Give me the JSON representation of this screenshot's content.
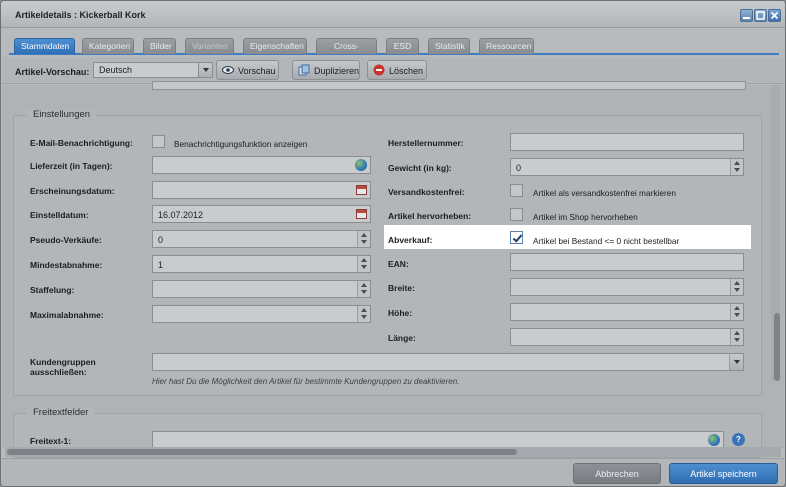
{
  "window": {
    "title": "Artikeldetails : Kickerball Kork"
  },
  "tabs": [
    {
      "label": "Stammdaten",
      "state": "active"
    },
    {
      "label": "Kategorien",
      "state": "normal"
    },
    {
      "label": "Bilder",
      "state": "normal"
    },
    {
      "label": "Varianten",
      "state": "disabled"
    },
    {
      "label": "Eigenschaften",
      "state": "normal"
    },
    {
      "label": "Cross-Selling",
      "state": "normal"
    },
    {
      "label": "ESD",
      "state": "normal"
    },
    {
      "label": "Statistik",
      "state": "normal"
    },
    {
      "label": "Ressourcen",
      "state": "normal"
    }
  ],
  "toolbar": {
    "preview_label": "Artikel-Vorschau:",
    "language_value": "Deutsch",
    "preview_button": "Vorschau",
    "duplicate_button": "Duplizieren",
    "delete_button": "Löschen"
  },
  "settings": {
    "legend": "Einstellungen",
    "left": {
      "email_label": "E-Mail-Benachrichtigung:",
      "email_checkbox_text": "Benachrichtigungsfunktion anzeigen",
      "email_checked": false,
      "delivery_label": "Lieferzeit (in Tagen):",
      "delivery_value": "",
      "release_label": "Erscheinungsdatum:",
      "release_value": "",
      "added_label": "Einstelldatum:",
      "added_value": "16.07.2012",
      "pseudo_label": "Pseudo-Verkäufe:",
      "pseudo_value": "0",
      "min_label": "Mindestabnahme:",
      "min_value": "1",
      "graduation_label": "Staffelung:",
      "graduation_value": "",
      "max_label": "Maximalabnahme:",
      "max_value": ""
    },
    "right": {
      "manufacturer_no_label": "Herstellernummer:",
      "manufacturer_no_value": "",
      "weight_label": "Gewicht (in kg):",
      "weight_value": "0",
      "shipping_free_label": "Versandkostenfrei:",
      "shipping_free_text": "Artikel als versandkostenfrei markieren",
      "shipping_free_checked": false,
      "highlight_label": "Artikel hervorheben:",
      "highlight_text": "Artikel im Shop hervorheben",
      "highlight_checked": false,
      "clearance_label": "Abverkauf:",
      "clearance_text": "Artikel bei Bestand <= 0 nicht bestellbar",
      "clearance_checked": true,
      "ean_label": "EAN:",
      "ean_value": "",
      "width_label": "Breite:",
      "width_value": "",
      "height_label": "Höhe:",
      "height_value": "",
      "length_label": "Länge:",
      "length_value": ""
    },
    "customer_groups_label_1": "Kundengruppen",
    "customer_groups_label_2": "ausschließen:",
    "customer_groups_value": "",
    "customer_groups_hint": "Hier hast Du die Möglichkeit den Artikel für bestimmte Kundengruppen zu deaktivieren."
  },
  "freetext": {
    "legend": "Freitextfelder",
    "field1_label": "Freitext-1:",
    "field1_value": "",
    "help_glyph": "?"
  },
  "footer": {
    "cancel_button": "Abbrechen",
    "save_button": "Artikel speichern"
  },
  "colors": {
    "accent": "#3a7bc4",
    "tab_active": "#3d82c9",
    "highlight_bg": "#ffffff"
  }
}
